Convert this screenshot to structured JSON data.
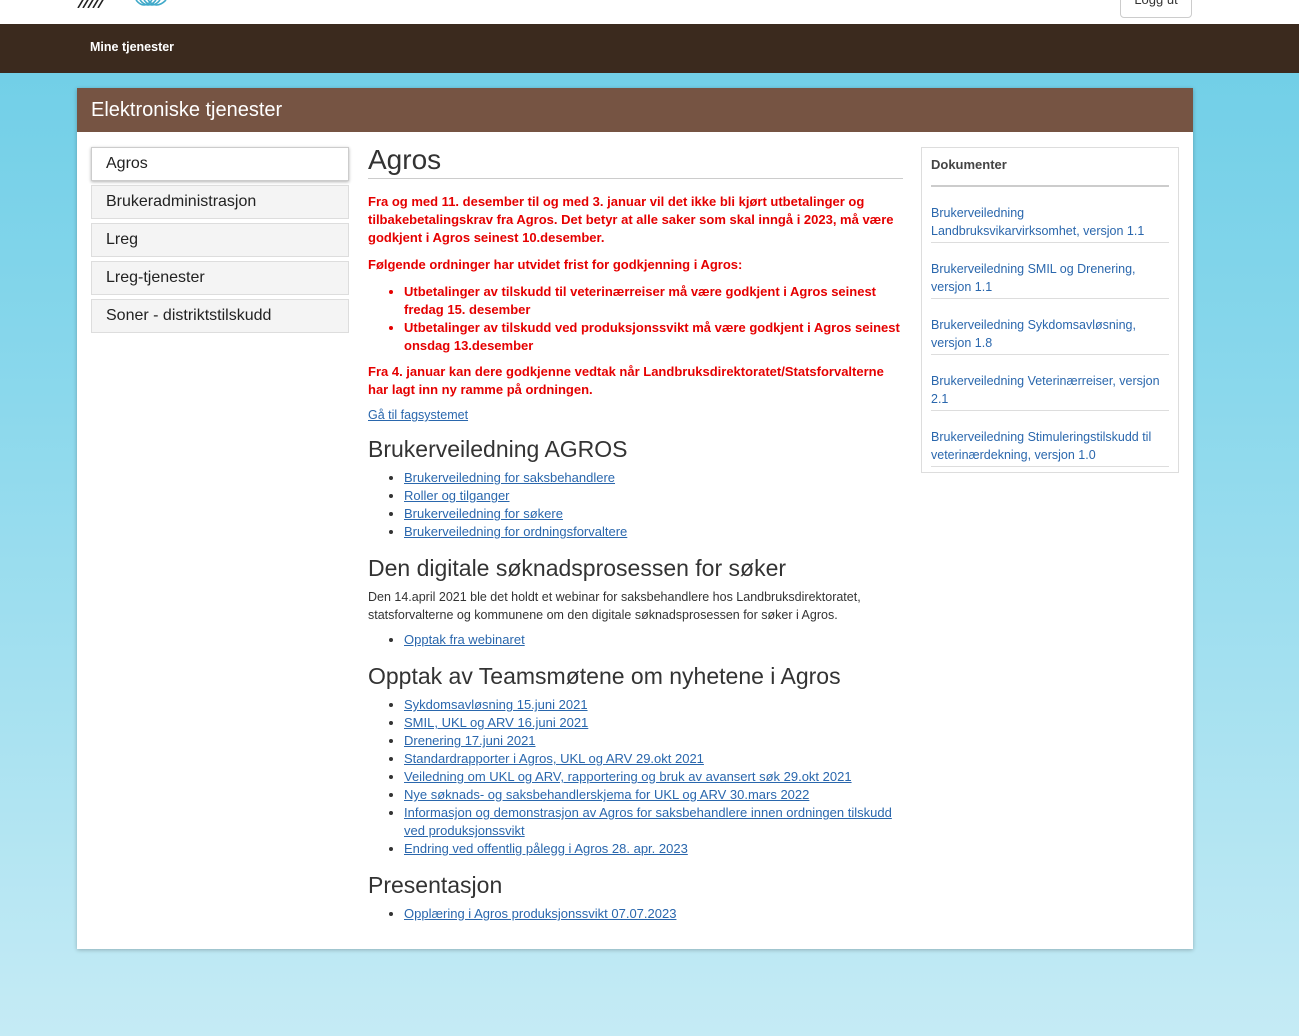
{
  "header": {
    "logout_label": "Logg ut"
  },
  "nav": {
    "mine_tjenester": "Mine tjenester"
  },
  "panel": {
    "title": "Elektroniske tjenester"
  },
  "sidebar": {
    "items": [
      {
        "label": "Agros"
      },
      {
        "label": "Brukeradministrasjon"
      },
      {
        "label": "Lreg"
      },
      {
        "label": "Lreg-tjenester"
      },
      {
        "label": "Soner - distriktstilskudd"
      }
    ]
  },
  "main": {
    "title": "Agros",
    "notice_1": "Fra og med 11. desember til og med 3. januar vil det ikke bli kjørt utbetalinger og tilbakebetalingskrav fra Agros. Det betyr at alle saker som skal inngå i 2023, må være godkjent i Agros seinest 10.desember.",
    "notice_2": "Følgende ordninger har utvidet frist for godkjenning i Agros:",
    "notice_list": [
      "Utbetalinger av tilskudd til veterinærreiser må være godkjent i Agros seinest fredag 15. desember",
      "Utbetalinger av tilskudd ved produksjonssvikt må være godkjent i Agros seinest onsdag 13.desember"
    ],
    "notice_3": "Fra 4. januar kan dere godkjenne vedtak når Landbruksdirektoratet/Statsforvalterne har lagt inn ny ramme på ordningen.",
    "fagsystem_link": "Gå til fagsystemet",
    "section_brukerveiledning": {
      "title": "Brukerveiledning AGROS",
      "links": [
        "Brukerveiledning for saksbehandlere",
        "Roller og tilganger",
        "Brukerveiledning for søkere",
        "Brukerveiledning for ordningsforvaltere"
      ]
    },
    "section_digital": {
      "title": "Den digitale søknadsprosessen for søker",
      "text": "Den 14.april 2021 ble det holdt et webinar for saksbehandlere hos Landbruksdirektoratet, statsforvalterne og kommunene om den digitale søknadsprosessen for søker i Agros.",
      "links": [
        "Opptak fra webinaret"
      ]
    },
    "section_teams": {
      "title": "Opptak av Teamsmøtene om nyhetene i Agros",
      "links": [
        "Sykdomsavløsning 15.juni 2021",
        "SMIL, UKL og ARV 16.juni 2021",
        "Drenering 17.juni 2021",
        "Standardrapporter i Agros, UKL og ARV 29.okt 2021",
        "Veiledning om UKL og ARV, rapportering og bruk av avansert søk 29.okt 2021",
        "Nye søknads- og saksbehandlerskjema for UKL og ARV 30.mars 2022",
        "Informasjon og demonstrasjon av Agros for saksbehandlere innen ordningen tilskudd ved produksjonssvikt",
        "Endring ved offentlig pålegg i Agros 28. apr. 2023"
      ]
    },
    "section_presentasjon": {
      "title": "Presentasjon",
      "links": [
        "Opplæring i Agros produksjonssvikt 07.07.2023"
      ]
    }
  },
  "documents": {
    "heading": "Dokumenter",
    "items": [
      "Brukerveiledning Landbruksvikarvirksomhet, versjon 1.1",
      "Brukerveiledning SMIL og Drenering, versjon 1.1",
      "Brukerveiledning Sykdomsavløsning, versjon 1.8",
      "Brukerveiledning Veterinærreiser, versjon 2.1",
      "Brukerveiledning Stimuleringstilskudd til veterinærdekning, versjon 1.0"
    ]
  }
}
